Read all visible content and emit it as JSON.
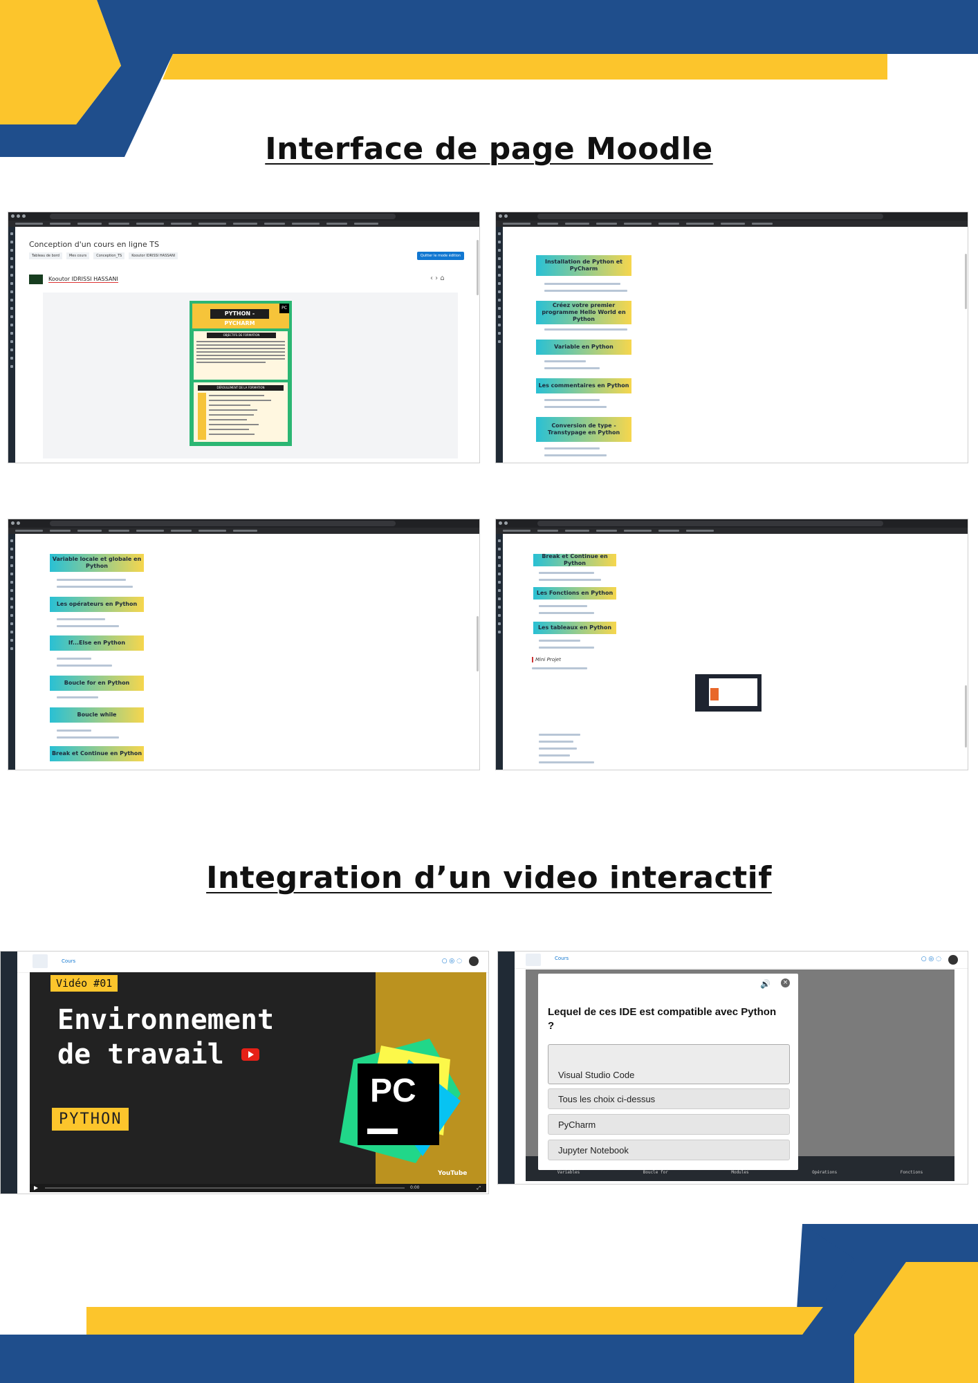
{
  "headings": {
    "moodle": "Interface de page Moodle",
    "video": "Integration d’un video interactif "
  },
  "shot1": {
    "course_title": "Conception d'un cours en ligne TS",
    "breadcrumbs": [
      "Tableau de bord",
      "Mes cours",
      "Conception_TS",
      "Kooutor IDRISSI HASSANI"
    ],
    "edit_button": "Quitter le mode édition",
    "section_title": "Kooutor IDRISSI HASSANI",
    "poster_title": "PYTHON - PYCHARM",
    "poster_objectifs": "OBJECTIFS DE FORMATION",
    "poster_deroulement": "DÉROULEMENT DE LA FORMATION"
  },
  "shot2": {
    "sections": [
      "Installation de Python et PyCharm",
      "Créez votre premier programme Hello World en Python",
      "Variable en Python",
      "Les commentaires en Python",
      "Conversion de type - Transtypage en Python"
    ]
  },
  "shot3": {
    "sections": [
      "Variable locale et globale en Python",
      "Les opérateurs en Python",
      "If...Else en Python",
      "Boucle for en Python",
      "Boucle while",
      "Break et Continue en Python"
    ]
  },
  "shot4": {
    "sections": [
      "Break et Continue en Python",
      "Les Fonctions en Python",
      "Les tableaux en Python"
    ],
    "mini_projet": "Mini Projet"
  },
  "video": {
    "nav_label": "Cours",
    "badge": "Vidéo #01",
    "title_line1": "Environnement",
    "title_line2": "de travail",
    "tag": "PYTHON",
    "logo_text": "PC",
    "youtube": "YouTube",
    "time": "0:00"
  },
  "quiz": {
    "nav_label": "Cours",
    "question": "Lequel de ces IDE est compatible avec Python ?",
    "options": [
      "Visual Studio Code",
      "Tous les choix ci-dessus",
      "PyCharm",
      "Jupyter Notebook"
    ],
    "bottom_bar": [
      "Variables",
      "Boucle for",
      "Modules",
      "Opérations",
      "Fonctions"
    ]
  },
  "colors": {
    "navy": "#1f4e8c",
    "yellow": "#fcc52c",
    "moodle_blue": "#1177d1"
  }
}
